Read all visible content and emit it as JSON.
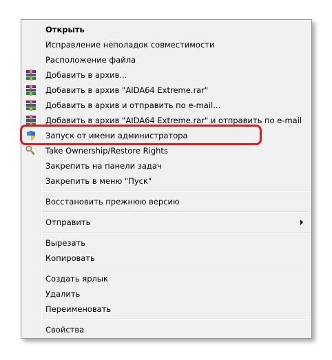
{
  "context_menu": {
    "items": [
      {
        "label": "Открыть",
        "icon": "none",
        "bold": true
      },
      {
        "label": "Исправление неполадок совместимости",
        "icon": "none"
      },
      {
        "label": "Расположение файла",
        "icon": "none"
      },
      {
        "label": "Добавить в архив...",
        "icon": "winrar-icon"
      },
      {
        "label": "Добавить в архив \"AIDA64 Extreme.rar\"",
        "icon": "winrar-icon"
      },
      {
        "label": "Добавить в архив и отправить по e-mail...",
        "icon": "winrar-icon"
      },
      {
        "label": "Добавить в архив \"AIDA64 Extreme.rar\" и отправить по e-mail",
        "icon": "winrar-icon"
      },
      {
        "label": "Запуск от имени администратора",
        "icon": "uac-shield-icon"
      },
      {
        "label": "Take Ownership/Restore Rights",
        "icon": "key-icon"
      },
      {
        "label": "Закрепить на панели задач",
        "icon": "none"
      },
      {
        "label": "Закрепить в меню \"Пуск\"",
        "icon": "none"
      },
      {
        "label": "Восстановить прежнюю версию",
        "icon": "none"
      },
      {
        "label": "Отправить",
        "icon": "none",
        "submenu": true
      },
      {
        "label": "Вырезать",
        "icon": "none"
      },
      {
        "label": "Копировать",
        "icon": "none"
      },
      {
        "label": "Создать ярлык",
        "icon": "none"
      },
      {
        "label": "Удалить",
        "icon": "none"
      },
      {
        "label": "Переименовать",
        "icon": "none"
      },
      {
        "label": "Свойства",
        "icon": "none"
      }
    ]
  },
  "colors": {
    "menu_background": "#f0f0f0",
    "highlight_outline": "#e11b22",
    "text": "#000000"
  }
}
